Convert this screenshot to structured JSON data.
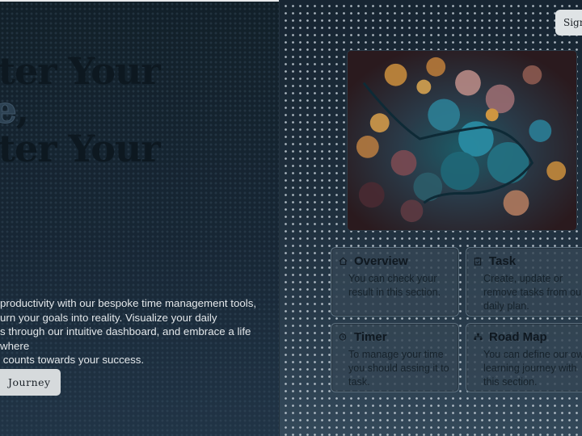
{
  "hero": {
    "title_lines": [
      "aster Your",
      "me,",
      "aster Your",
      "e"
    ],
    "description": "productivity with our bespoke time management tools, urn your goals into reality. Visualize your daily s through our intuitive dashboard, and embrace a life where counts towards your success.",
    "description_lines": [
      "productivity with our bespoke time management tools,",
      "urn your goals into reality. Visualize your daily",
      "s through our intuitive dashboard, and embrace a life where",
      " counts towards your success."
    ],
    "cta_label": "Journey"
  },
  "header": {
    "signin_label": "Sign"
  },
  "photo": {
    "alt": "Aerial view of autumn forest with winding road"
  },
  "cards": [
    {
      "icon": "home-icon",
      "title": "Overview",
      "text_lines": [
        "You can check your",
        "result in this section."
      ]
    },
    {
      "icon": "clipboard-icon",
      "title": "Task",
      "text_lines": [
        "Create, update or",
        "remove tasks from our",
        "daily plan."
      ]
    },
    {
      "icon": "timer-icon",
      "title": "Timer",
      "text_lines": [
        "To manage your time",
        "you should assing it to",
        "task."
      ]
    },
    {
      "icon": "sitemap-icon",
      "title": "Road Map",
      "text_lines": [
        "You can define our own",
        "learning journey with",
        "this section."
      ]
    }
  ],
  "colors": {
    "hero_bg": "#15222e",
    "side_bg": "#1b2a37",
    "button_bg": "#d6dadc",
    "card_bg": "#344654",
    "title_dark": "#0d1820",
    "title_accent": "#2c4152"
  }
}
